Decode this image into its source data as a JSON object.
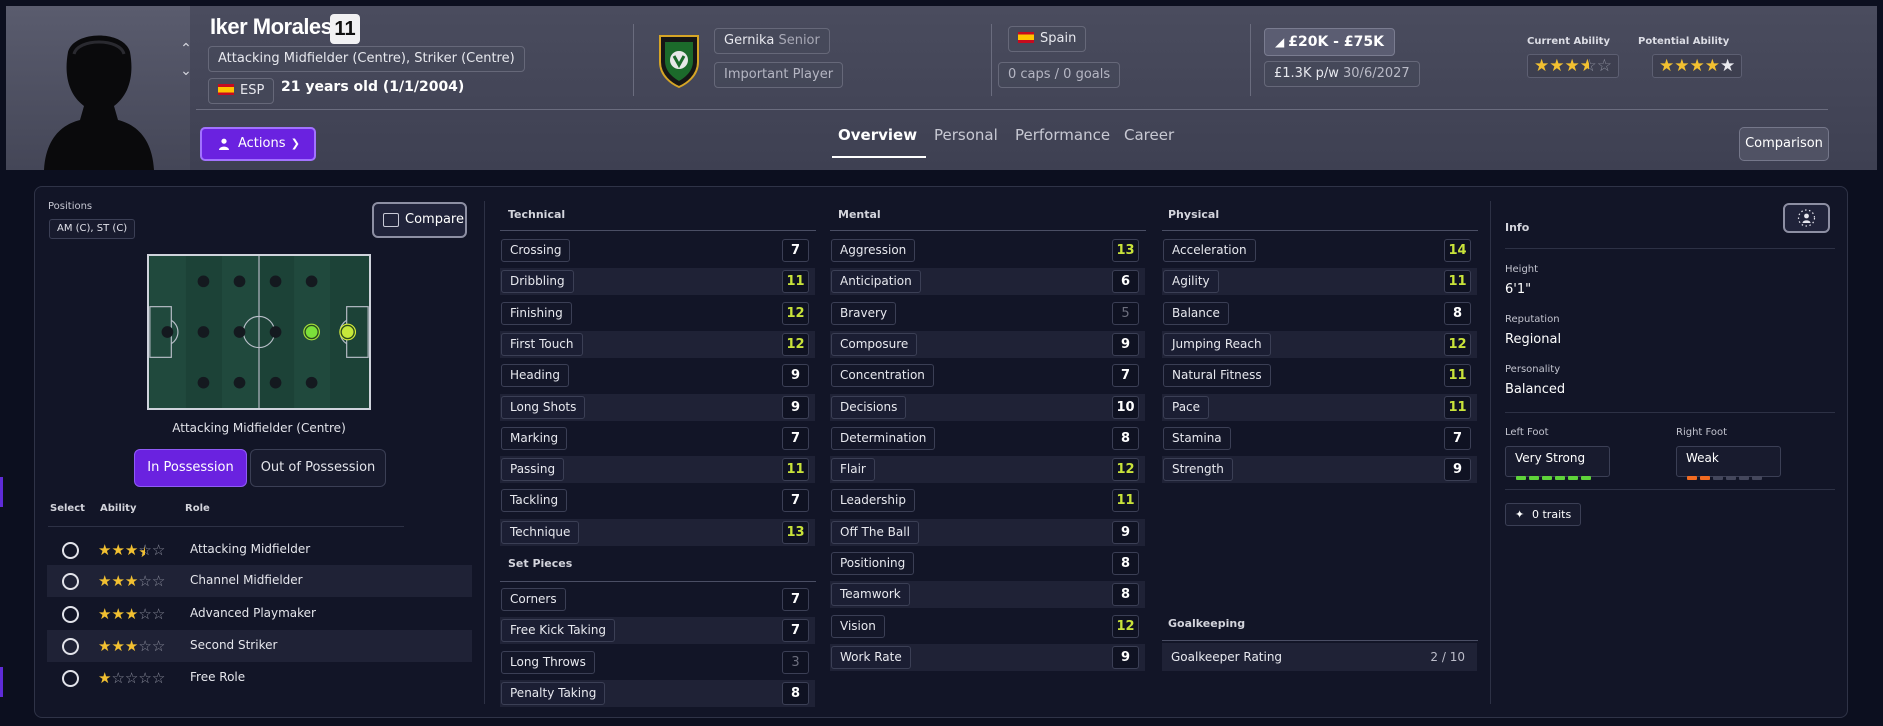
{
  "header": {
    "player_name": "Iker Morales",
    "shirt_number": "11",
    "positions_text": "Attacking Midfielder (Centre), Striker (Centre)",
    "nationality_code": "ESP",
    "age_text": "21 years old (1/1/2004)",
    "club": "Gernika",
    "squad": "Senior",
    "squad_status": "Important Player",
    "nation": "Spain",
    "caps_goals": "0 caps / 0 goals",
    "value_range": "£20K - £75K",
    "wage": "£1.3K p/w",
    "contract_end": "30/6/2027",
    "current_ability_label": "Current Ability",
    "current_ability_stars": 3.5,
    "potential_ability_label": "Potential Ability",
    "potential_ability_stars": 4.5,
    "actions_label": "Actions",
    "comparison_label": "Comparison",
    "tabs": [
      {
        "label": "Overview",
        "active": true
      },
      {
        "label": "Personal",
        "active": false
      },
      {
        "label": "Performance",
        "active": false
      },
      {
        "label": "Career",
        "active": false
      }
    ]
  },
  "positions_panel": {
    "label": "Positions",
    "position_codes": "AM (C), ST (C)",
    "compare_label": "Compare",
    "pitch_caption": "Attacking Midfielder (Centre)",
    "in_possession_label": "In Possession",
    "out_of_possession_label": "Out of Possession",
    "col_select": "Select",
    "col_ability": "Ability",
    "col_role": "Role",
    "roles": [
      {
        "name": "Attacking Midfielder",
        "stars": 3.5
      },
      {
        "name": "Channel Midfielder",
        "stars": 3
      },
      {
        "name": "Advanced Playmaker",
        "stars": 3
      },
      {
        "name": "Second Striker",
        "stars": 3
      },
      {
        "name": "Free Role",
        "stars": 1
      }
    ]
  },
  "technical": {
    "title": "Technical",
    "attrs": [
      {
        "name": "Crossing",
        "value": "7"
      },
      {
        "name": "Dribbling",
        "value": "11"
      },
      {
        "name": "Finishing",
        "value": "12"
      },
      {
        "name": "First Touch",
        "value": "12"
      },
      {
        "name": "Heading",
        "value": "9"
      },
      {
        "name": "Long Shots",
        "value": "9"
      },
      {
        "name": "Marking",
        "value": "7"
      },
      {
        "name": "Passing",
        "value": "11"
      },
      {
        "name": "Tackling",
        "value": "7"
      },
      {
        "name": "Technique",
        "value": "13"
      }
    ]
  },
  "set_pieces": {
    "title": "Set Pieces",
    "attrs": [
      {
        "name": "Corners",
        "value": "7"
      },
      {
        "name": "Free Kick Taking",
        "value": "7"
      },
      {
        "name": "Long Throws",
        "value": "3"
      },
      {
        "name": "Penalty Taking",
        "value": "8"
      }
    ]
  },
  "mental": {
    "title": "Mental",
    "attrs": [
      {
        "name": "Aggression",
        "value": "13"
      },
      {
        "name": "Anticipation",
        "value": "6"
      },
      {
        "name": "Bravery",
        "value": "5"
      },
      {
        "name": "Composure",
        "value": "9"
      },
      {
        "name": "Concentration",
        "value": "7"
      },
      {
        "name": "Decisions",
        "value": "10"
      },
      {
        "name": "Determination",
        "value": "8"
      },
      {
        "name": "Flair",
        "value": "12"
      },
      {
        "name": "Leadership",
        "value": "11"
      },
      {
        "name": "Off The Ball",
        "value": "9"
      },
      {
        "name": "Positioning",
        "value": "8"
      },
      {
        "name": "Teamwork",
        "value": "8"
      },
      {
        "name": "Vision",
        "value": "12"
      },
      {
        "name": "Work Rate",
        "value": "9"
      }
    ]
  },
  "physical": {
    "title": "Physical",
    "attrs": [
      {
        "name": "Acceleration",
        "value": "14"
      },
      {
        "name": "Agility",
        "value": "11"
      },
      {
        "name": "Balance",
        "value": "8"
      },
      {
        "name": "Jumping Reach",
        "value": "12"
      },
      {
        "name": "Natural Fitness",
        "value": "11"
      },
      {
        "name": "Pace",
        "value": "11"
      },
      {
        "name": "Stamina",
        "value": "7"
      },
      {
        "name": "Strength",
        "value": "9"
      }
    ]
  },
  "goalkeeping": {
    "title": "Goalkeeping",
    "rating_label": "Goalkeeper Rating",
    "rating_value": "2 / 10"
  },
  "info": {
    "title": "Info",
    "height_label": "Height",
    "height_value": "6'1\"",
    "reputation_label": "Reputation",
    "reputation_value": "Regional",
    "personality_label": "Personality",
    "personality_value": "Balanced",
    "left_foot_label": "Left Foot",
    "left_foot_value": "Very Strong",
    "left_foot_level": 6,
    "right_foot_label": "Right Foot",
    "right_foot_value": "Weak",
    "right_foot_level": 2,
    "traits_label": "0 traits"
  },
  "colors": {
    "accent_purple": "#6a22e0",
    "good_value": "#c9e33a",
    "low_value": "#6d6f7e",
    "star": "#f2c031",
    "foot_strong": "#5fd43a",
    "foot_weak": "#f26b21"
  }
}
